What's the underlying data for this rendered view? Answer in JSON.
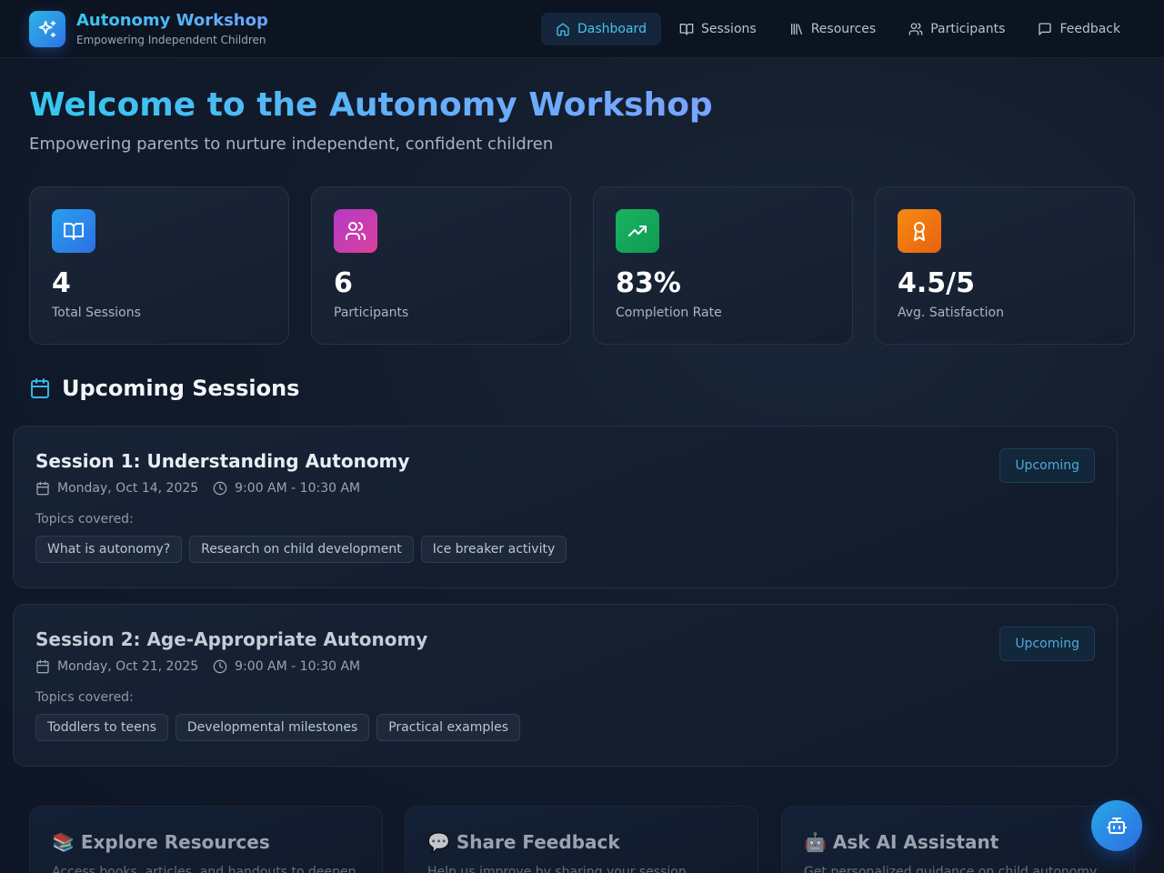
{
  "brand": {
    "title": "Autonomy Workshop",
    "subtitle": "Empowering Independent Children",
    "icon": "sparkles-icon"
  },
  "nav": {
    "items": [
      {
        "label": "Dashboard",
        "icon": "home-icon",
        "active": true
      },
      {
        "label": "Sessions",
        "icon": "book-open-icon",
        "active": false
      },
      {
        "label": "Resources",
        "icon": "library-icon",
        "active": false
      },
      {
        "label": "Participants",
        "icon": "users-icon",
        "active": false
      },
      {
        "label": "Feedback",
        "icon": "message-square-icon",
        "active": false
      }
    ]
  },
  "hero": {
    "title": "Welcome to the Autonomy Workshop",
    "subtitle": "Empowering parents to nurture independent, confident children"
  },
  "stats": [
    {
      "value": "4",
      "label": "Total Sessions",
      "icon": "book-open-icon",
      "color": "#2f86e6"
    },
    {
      "value": "6",
      "label": "Participants",
      "icon": "users-icon",
      "color": "#c23fb3"
    },
    {
      "value": "83%",
      "label": "Completion Rate",
      "icon": "trending-up-icon",
      "color": "#17a55c"
    },
    {
      "value": "4.5/5",
      "label": "Avg. Satisfaction",
      "icon": "award-icon",
      "color": "#f07a10"
    }
  ],
  "upcoming": {
    "title": "Upcoming Sessions",
    "sessions": [
      {
        "title": "Session 1: Understanding Autonomy",
        "date": "Monday, Oct 14, 2025",
        "time": "9:00 AM - 10:30 AM",
        "topics_label": "Topics covered:",
        "topics": [
          "What is autonomy?",
          "Research on child development",
          "Ice breaker activity"
        ],
        "status": "Upcoming"
      },
      {
        "title": "Session 2: Age-Appropriate Autonomy",
        "date": "Monday, Oct 21, 2025",
        "time": "9:00 AM - 10:30 AM",
        "topics_label": "Topics covered:",
        "topics": [
          "Toddlers to teens",
          "Developmental milestones",
          "Practical examples"
        ],
        "status": "Upcoming"
      }
    ]
  },
  "actions": [
    {
      "title": "📚 Explore Resources",
      "desc": "Access books, articles, and handouts to deepen"
    },
    {
      "title": "💬 Share Feedback",
      "desc": "Help us improve by sharing your session"
    },
    {
      "title": "🤖 Ask AI Assistant",
      "desc": "Get personalized guidance on child autonomy"
    }
  ],
  "fab": {
    "icon": "bot-icon"
  }
}
